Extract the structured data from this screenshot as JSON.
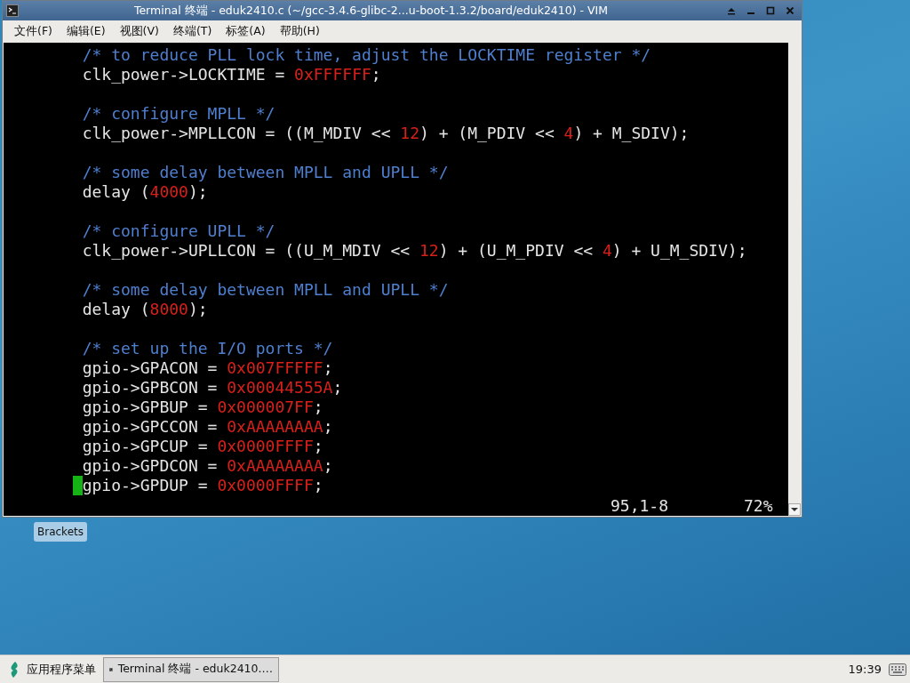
{
  "window": {
    "title": "Terminal 终端 - eduk2410.c (~/gcc-3.4.6-glibc-2...u-boot-1.3.2/board/eduk2410) - VIM"
  },
  "menu": [
    "文件(F)",
    "编辑(E)",
    "视图(V)",
    "终端(T)",
    "标签(A)",
    "帮助(H)"
  ],
  "editor": {
    "blocks": [
      {
        "lines": [
          {
            "cursor": false,
            "segments": [
              {
                "kind": "comment",
                "text": "/* to reduce PLL lock time, adjust the LOCKTIME register */"
              }
            ]
          },
          {
            "cursor": false,
            "segments": [
              {
                "kind": "plain",
                "text": "clk_power->LOCKTIME = "
              },
              {
                "kind": "number",
                "text": "0xFFFFFF"
              },
              {
                "kind": "plain",
                "text": ";"
              }
            ]
          }
        ]
      },
      {
        "lines": [
          {
            "cursor": false,
            "segments": [
              {
                "kind": "comment",
                "text": "/* configure MPLL */"
              }
            ]
          },
          {
            "cursor": false,
            "segments": [
              {
                "kind": "plain",
                "text": "clk_power->MPLLCON = ((M_MDIV << "
              },
              {
                "kind": "number",
                "text": "12"
              },
              {
                "kind": "plain",
                "text": ") + (M_PDIV << "
              },
              {
                "kind": "number",
                "text": "4"
              },
              {
                "kind": "plain",
                "text": ") + M_SDIV);"
              }
            ]
          }
        ]
      },
      {
        "lines": [
          {
            "cursor": false,
            "segments": [
              {
                "kind": "comment",
                "text": "/* some delay between MPLL and UPLL */"
              }
            ]
          },
          {
            "cursor": false,
            "segments": [
              {
                "kind": "plain",
                "text": "delay ("
              },
              {
                "kind": "number",
                "text": "4000"
              },
              {
                "kind": "plain",
                "text": ");"
              }
            ]
          }
        ]
      },
      {
        "lines": [
          {
            "cursor": false,
            "segments": [
              {
                "kind": "comment",
                "text": "/* configure UPLL */"
              }
            ]
          },
          {
            "cursor": false,
            "segments": [
              {
                "kind": "plain",
                "text": "clk_power->UPLLCON = ((U_M_MDIV << "
              },
              {
                "kind": "number",
                "text": "12"
              },
              {
                "kind": "plain",
                "text": ") + (U_M_PDIV << "
              },
              {
                "kind": "number",
                "text": "4"
              },
              {
                "kind": "plain",
                "text": ") + U_M_SDIV);"
              }
            ]
          }
        ]
      },
      {
        "lines": [
          {
            "cursor": false,
            "segments": [
              {
                "kind": "comment",
                "text": "/* some delay between MPLL and UPLL */"
              }
            ]
          },
          {
            "cursor": false,
            "segments": [
              {
                "kind": "plain",
                "text": "delay ("
              },
              {
                "kind": "number",
                "text": "8000"
              },
              {
                "kind": "plain",
                "text": ");"
              }
            ]
          }
        ]
      },
      {
        "lines": [
          {
            "cursor": false,
            "segments": [
              {
                "kind": "comment",
                "text": "/* set up the I/O ports */"
              }
            ]
          },
          {
            "cursor": false,
            "segments": [
              {
                "kind": "plain",
                "text": "gpio->GPACON = "
              },
              {
                "kind": "number",
                "text": "0x007FFFFF"
              },
              {
                "kind": "plain",
                "text": ";"
              }
            ]
          },
          {
            "cursor": false,
            "segments": [
              {
                "kind": "plain",
                "text": "gpio->GPBCON = "
              },
              {
                "kind": "number",
                "text": "0x00044555A"
              },
              {
                "kind": "plain",
                "text": ";"
              }
            ]
          },
          {
            "cursor": false,
            "segments": [
              {
                "kind": "plain",
                "text": "gpio->GPBUP = "
              },
              {
                "kind": "number",
                "text": "0x000007FF"
              },
              {
                "kind": "plain",
                "text": ";"
              }
            ]
          },
          {
            "cursor": false,
            "segments": [
              {
                "kind": "plain",
                "text": "gpio->GPCCON = "
              },
              {
                "kind": "number",
                "text": "0xAAAAAAAA"
              },
              {
                "kind": "plain",
                "text": ";"
              }
            ]
          },
          {
            "cursor": false,
            "segments": [
              {
                "kind": "plain",
                "text": "gpio->GPCUP = "
              },
              {
                "kind": "number",
                "text": "0x0000FFFF"
              },
              {
                "kind": "plain",
                "text": ";"
              }
            ]
          },
          {
            "cursor": false,
            "segments": [
              {
                "kind": "plain",
                "text": "gpio->GPDCON = "
              },
              {
                "kind": "number",
                "text": "0xAAAAAAAA"
              },
              {
                "kind": "plain",
                "text": ";"
              }
            ]
          },
          {
            "cursor": true,
            "segments": [
              {
                "kind": "plain",
                "text": "gpio->GPDUP = "
              },
              {
                "kind": "number",
                "text": "0x0000FFFF"
              },
              {
                "kind": "plain",
                "text": ";"
              }
            ]
          }
        ]
      }
    ],
    "status": {
      "position": "95,1-8",
      "percent": "72%"
    }
  },
  "desktop": {
    "label": "Brackets"
  },
  "taskbar": {
    "app_menu": "应用程序菜单",
    "task": "Terminal 终端 - eduk2410.…",
    "clock": "19:39"
  }
}
